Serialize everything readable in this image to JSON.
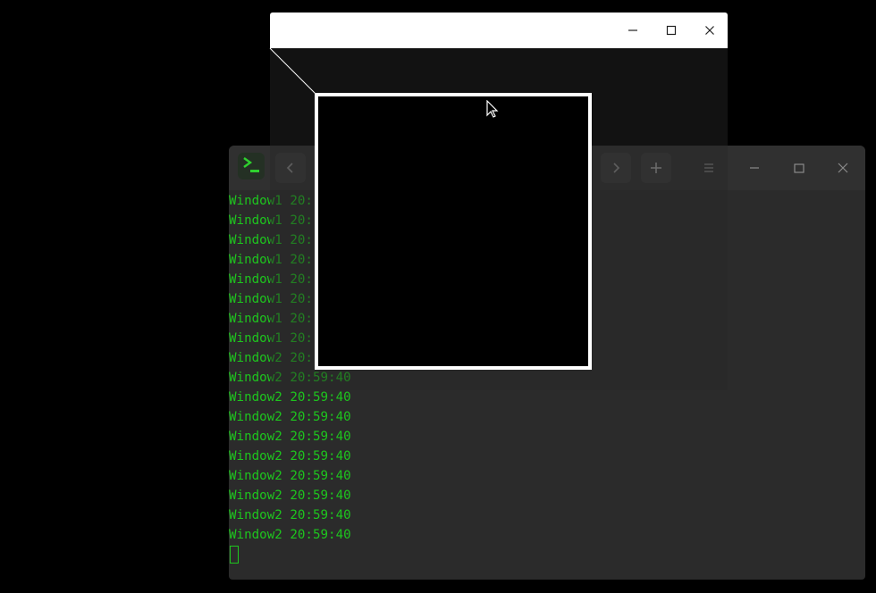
{
  "terminal": {
    "header": {
      "app_icon": "terminal-icon",
      "back_icon": "chevron-left-icon",
      "forward_icon": "chevron-right-icon",
      "new_tab_icon": "plus-icon",
      "menu_icon": "hamburger-menu-icon",
      "minimize_icon": "minimize-icon",
      "maximize_icon": "maximize-icon",
      "close_icon": "close-icon"
    },
    "lines": [
      "Window1 20:",
      "Window1 20:",
      "Window1 20:",
      "Window1 20:",
      "Window1 20:",
      "Window1 20:",
      "Window1 20:",
      "Window1 20:",
      "Window2 20:",
      "Window2 20:59:40",
      "Window2 20:59:40",
      "Window2 20:59:40",
      "Window2 20:59:40",
      "Window2 20:59:40",
      "Window2 20:59:40",
      "Window2 20:59:40",
      "Window2 20:59:40",
      "Window2 20:59:40"
    ],
    "colors": {
      "text": "#1ec51e",
      "background": "#2b2b2b",
      "header": "#303030"
    }
  },
  "overlay_window": {
    "title": "",
    "minimize_icon": "minimize-icon",
    "maximize_icon": "maximize-icon",
    "close_icon": "close-icon"
  },
  "magnifier": {
    "border_color": "#ffffff"
  }
}
